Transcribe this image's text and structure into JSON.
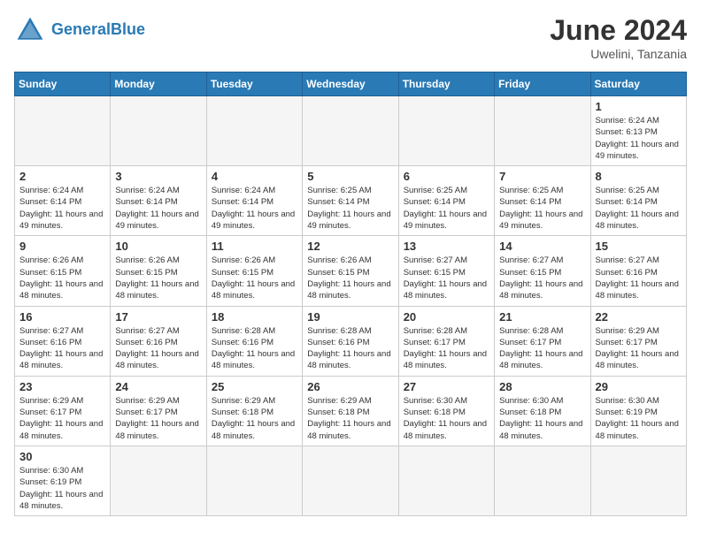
{
  "header": {
    "logo_general": "General",
    "logo_blue": "Blue",
    "month_title": "June 2024",
    "subtitle": "Uwelini, Tanzania"
  },
  "days_of_week": [
    "Sunday",
    "Monday",
    "Tuesday",
    "Wednesday",
    "Thursday",
    "Friday",
    "Saturday"
  ],
  "weeks": [
    [
      {
        "day": "",
        "info": ""
      },
      {
        "day": "",
        "info": ""
      },
      {
        "day": "",
        "info": ""
      },
      {
        "day": "",
        "info": ""
      },
      {
        "day": "",
        "info": ""
      },
      {
        "day": "",
        "info": ""
      },
      {
        "day": "1",
        "info": "Sunrise: 6:24 AM\nSunset: 6:13 PM\nDaylight: 11 hours and 49 minutes."
      }
    ],
    [
      {
        "day": "2",
        "info": "Sunrise: 6:24 AM\nSunset: 6:14 PM\nDaylight: 11 hours and 49 minutes."
      },
      {
        "day": "3",
        "info": "Sunrise: 6:24 AM\nSunset: 6:14 PM\nDaylight: 11 hours and 49 minutes."
      },
      {
        "day": "4",
        "info": "Sunrise: 6:24 AM\nSunset: 6:14 PM\nDaylight: 11 hours and 49 minutes."
      },
      {
        "day": "5",
        "info": "Sunrise: 6:25 AM\nSunset: 6:14 PM\nDaylight: 11 hours and 49 minutes."
      },
      {
        "day": "6",
        "info": "Sunrise: 6:25 AM\nSunset: 6:14 PM\nDaylight: 11 hours and 49 minutes."
      },
      {
        "day": "7",
        "info": "Sunrise: 6:25 AM\nSunset: 6:14 PM\nDaylight: 11 hours and 49 minutes."
      },
      {
        "day": "8",
        "info": "Sunrise: 6:25 AM\nSunset: 6:14 PM\nDaylight: 11 hours and 48 minutes."
      }
    ],
    [
      {
        "day": "9",
        "info": "Sunrise: 6:26 AM\nSunset: 6:15 PM\nDaylight: 11 hours and 48 minutes."
      },
      {
        "day": "10",
        "info": "Sunrise: 6:26 AM\nSunset: 6:15 PM\nDaylight: 11 hours and 48 minutes."
      },
      {
        "day": "11",
        "info": "Sunrise: 6:26 AM\nSunset: 6:15 PM\nDaylight: 11 hours and 48 minutes."
      },
      {
        "day": "12",
        "info": "Sunrise: 6:26 AM\nSunset: 6:15 PM\nDaylight: 11 hours and 48 minutes."
      },
      {
        "day": "13",
        "info": "Sunrise: 6:27 AM\nSunset: 6:15 PM\nDaylight: 11 hours and 48 minutes."
      },
      {
        "day": "14",
        "info": "Sunrise: 6:27 AM\nSunset: 6:15 PM\nDaylight: 11 hours and 48 minutes."
      },
      {
        "day": "15",
        "info": "Sunrise: 6:27 AM\nSunset: 6:16 PM\nDaylight: 11 hours and 48 minutes."
      }
    ],
    [
      {
        "day": "16",
        "info": "Sunrise: 6:27 AM\nSunset: 6:16 PM\nDaylight: 11 hours and 48 minutes."
      },
      {
        "day": "17",
        "info": "Sunrise: 6:27 AM\nSunset: 6:16 PM\nDaylight: 11 hours and 48 minutes."
      },
      {
        "day": "18",
        "info": "Sunrise: 6:28 AM\nSunset: 6:16 PM\nDaylight: 11 hours and 48 minutes."
      },
      {
        "day": "19",
        "info": "Sunrise: 6:28 AM\nSunset: 6:16 PM\nDaylight: 11 hours and 48 minutes."
      },
      {
        "day": "20",
        "info": "Sunrise: 6:28 AM\nSunset: 6:17 PM\nDaylight: 11 hours and 48 minutes."
      },
      {
        "day": "21",
        "info": "Sunrise: 6:28 AM\nSunset: 6:17 PM\nDaylight: 11 hours and 48 minutes."
      },
      {
        "day": "22",
        "info": "Sunrise: 6:29 AM\nSunset: 6:17 PM\nDaylight: 11 hours and 48 minutes."
      }
    ],
    [
      {
        "day": "23",
        "info": "Sunrise: 6:29 AM\nSunset: 6:17 PM\nDaylight: 11 hours and 48 minutes."
      },
      {
        "day": "24",
        "info": "Sunrise: 6:29 AM\nSunset: 6:17 PM\nDaylight: 11 hours and 48 minutes."
      },
      {
        "day": "25",
        "info": "Sunrise: 6:29 AM\nSunset: 6:18 PM\nDaylight: 11 hours and 48 minutes."
      },
      {
        "day": "26",
        "info": "Sunrise: 6:29 AM\nSunset: 6:18 PM\nDaylight: 11 hours and 48 minutes."
      },
      {
        "day": "27",
        "info": "Sunrise: 6:30 AM\nSunset: 6:18 PM\nDaylight: 11 hours and 48 minutes."
      },
      {
        "day": "28",
        "info": "Sunrise: 6:30 AM\nSunset: 6:18 PM\nDaylight: 11 hours and 48 minutes."
      },
      {
        "day": "29",
        "info": "Sunrise: 6:30 AM\nSunset: 6:19 PM\nDaylight: 11 hours and 48 minutes."
      }
    ],
    [
      {
        "day": "30",
        "info": "Sunrise: 6:30 AM\nSunset: 6:19 PM\nDaylight: 11 hours and 48 minutes."
      },
      {
        "day": "",
        "info": ""
      },
      {
        "day": "",
        "info": ""
      },
      {
        "day": "",
        "info": ""
      },
      {
        "day": "",
        "info": ""
      },
      {
        "day": "",
        "info": ""
      },
      {
        "day": "",
        "info": ""
      }
    ]
  ]
}
